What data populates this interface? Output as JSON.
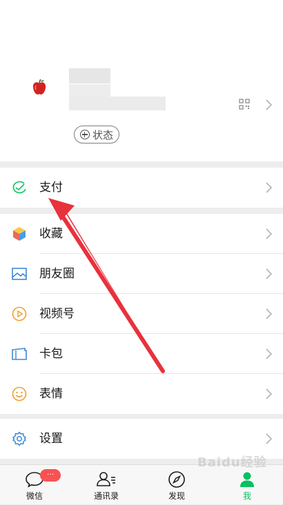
{
  "profile": {
    "status_label": "状态"
  },
  "menu": {
    "pay": "支付",
    "favorites": "收藏",
    "moments": "朋友圈",
    "channels": "视频号",
    "cards": "卡包",
    "stickers": "表情",
    "settings": "设置"
  },
  "tabbar": {
    "chats": "微信",
    "contacts": "通讯录",
    "discover": "发现",
    "me": "我",
    "chats_badge": "···",
    "active_tab": "me"
  },
  "watermark": "Baidu经验",
  "colors": {
    "accent_green": "#07c160",
    "badge_red": "#fa5151",
    "annotation_arrow": "#e8323c",
    "background": "#ededed"
  }
}
